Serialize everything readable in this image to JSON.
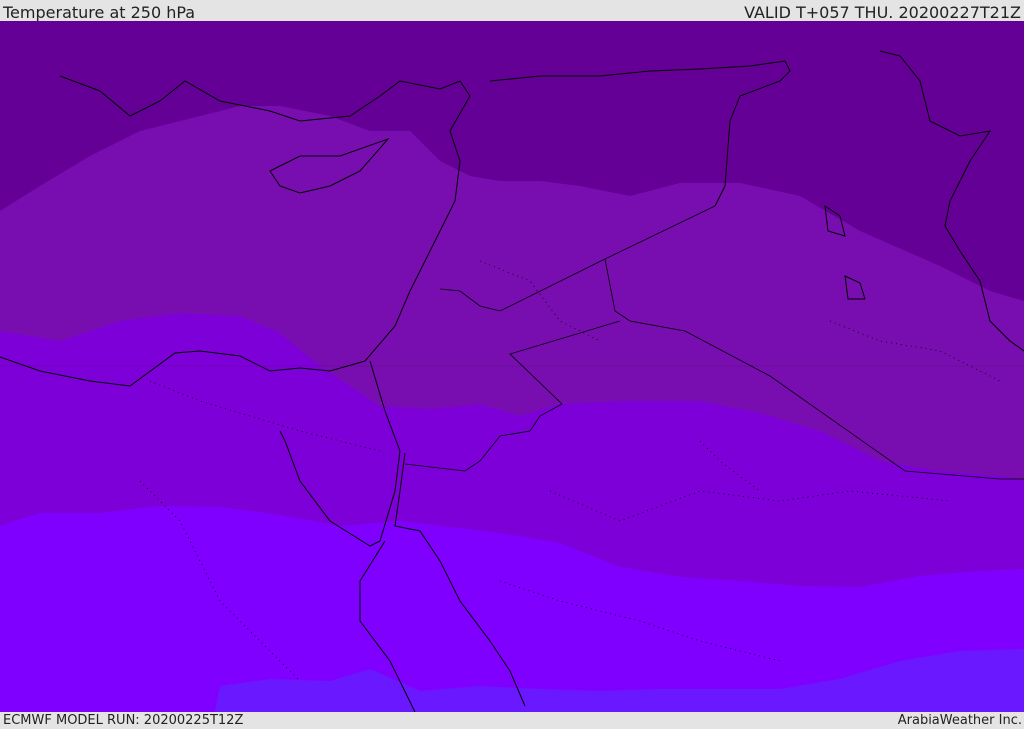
{
  "header": {
    "title": "Temperature at 250 hPa",
    "valid": "VALID T+057 THU. 20200227T21Z"
  },
  "footer": {
    "model_run": "ECMWF MODEL RUN: 20200225T12Z",
    "brand": "ArabiaWeather Inc."
  },
  "colors": {
    "band1": "#650096",
    "band2": "#790eb0",
    "band3": "#7e00d8",
    "band4": "#8000ff",
    "band5": "#6a18ff",
    "border": "#000000"
  }
}
